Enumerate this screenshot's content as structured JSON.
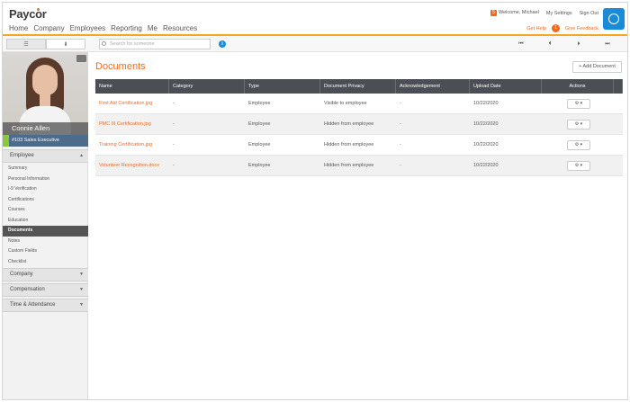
{
  "brand": {
    "logo": "Paycor"
  },
  "nav": [
    "Home",
    "Company",
    "Employees",
    "Reporting",
    "Me",
    "Resources"
  ],
  "top_right": {
    "message_count": "5",
    "welcome": "Welcome, Michael",
    "settings": "My Settings",
    "sign_out": "Sign Out",
    "get_help": "Get Help",
    "help_count": "1",
    "feedback": "Give Feedback"
  },
  "toolbar": {
    "search_placeholder": "Search for someone",
    "info": "i",
    "pager": [
      "⏮",
      "⏴",
      "⏵",
      "⏭"
    ]
  },
  "employee": {
    "name": "Connie Allen",
    "title": "#103 Sales Executive"
  },
  "sidebar": {
    "employee_section": "Employee",
    "items": [
      "Summary",
      "Personal Information",
      "I-9 Verification",
      "Certifications",
      "Courses",
      "Education",
      "Documents",
      "Notes",
      "Custom Fields",
      "Checklist"
    ],
    "active_item": "Documents",
    "sections": [
      "Company",
      "Compensation",
      "Time & Attendance"
    ]
  },
  "main": {
    "title": "Documents",
    "add_button": "+ Add Document",
    "columns": [
      "Name",
      "Category",
      "Type",
      "Document Privacy",
      "Acknowledgement",
      "Upload Date",
      "Actions"
    ],
    "rows": [
      {
        "name": "First Aid Certification.jpg",
        "category": "-",
        "type": "Employee",
        "privacy": "Visible to employee",
        "ack": "-",
        "date": "10/22/2020",
        "action": "⚙ ▾"
      },
      {
        "name": "PMC III Certification.jpg",
        "category": "-",
        "type": "Employee",
        "privacy": "Hidden from employee",
        "ack": "-",
        "date": "10/22/2020",
        "action": "⚙ ▾"
      },
      {
        "name": "Training Certification.jpg",
        "category": "-",
        "type": "Employee",
        "privacy": "Hidden from employee",
        "ack": "-",
        "date": "10/22/2020",
        "action": "⚙ ▾"
      },
      {
        "name": "Volunteer Recognition.docx",
        "category": "-",
        "type": "Employee",
        "privacy": "Hidden from employee",
        "ack": "-",
        "date": "10/22/2020",
        "action": "⚙ ▾"
      }
    ]
  }
}
